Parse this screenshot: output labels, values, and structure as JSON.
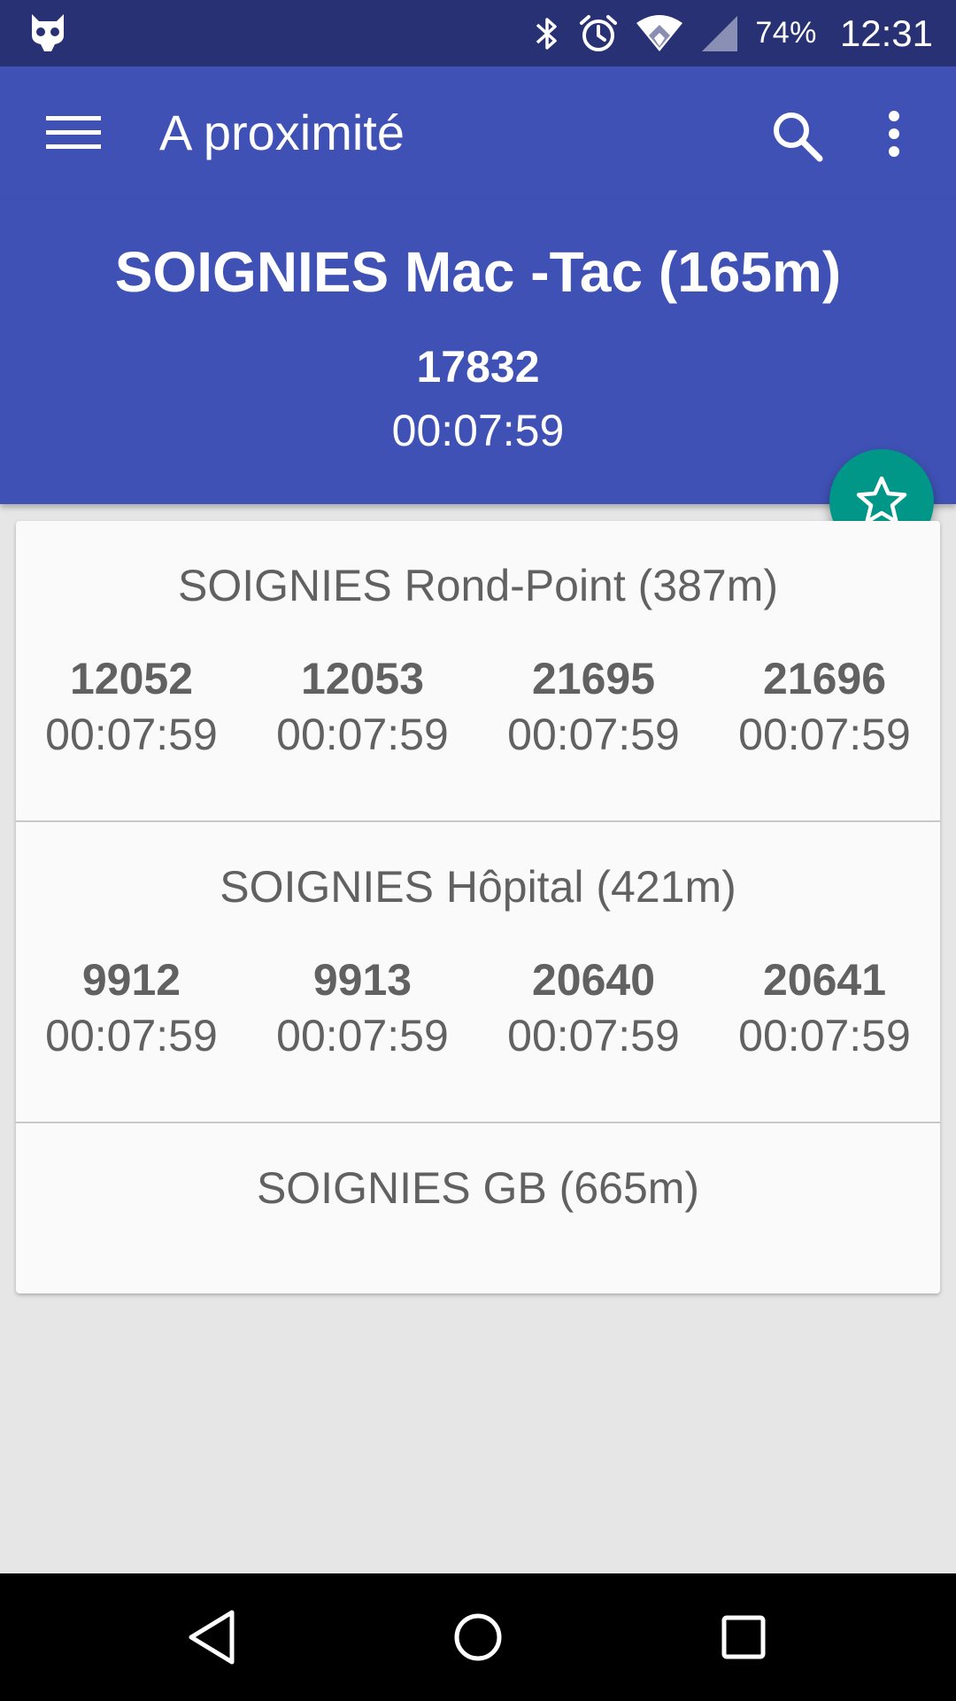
{
  "status_bar": {
    "battery": "74%",
    "time": "12:31",
    "icons": [
      "cyanogen-icon",
      "bluetooth-icon",
      "alarm-icon",
      "wifi-icon",
      "signal-icon"
    ]
  },
  "app_bar": {
    "title": "A proximité",
    "icons": [
      "menu-icon",
      "search-icon",
      "more-vert-icon"
    ]
  },
  "header": {
    "stop": "SOIGNIES Mac -Tac (165m)",
    "line": "17832",
    "time": "00:07:59"
  },
  "fab": {
    "icon": "star-outline-icon",
    "color": "#009688"
  },
  "stops": [
    {
      "name": "SOIGNIES Rond-Point (387m)",
      "departures": [
        {
          "line": "12052",
          "time": "00:07:59"
        },
        {
          "line": "12053",
          "time": "00:07:59"
        },
        {
          "line": "21695",
          "time": "00:07:59"
        },
        {
          "line": "21696",
          "time": "00:07:59"
        }
      ]
    },
    {
      "name": "SOIGNIES Hôpital (421m)",
      "departures": [
        {
          "line": "9912",
          "time": "00:07:59"
        },
        {
          "line": "9913",
          "time": "00:07:59"
        },
        {
          "line": "20640",
          "time": "00:07:59"
        },
        {
          "line": "20641",
          "time": "00:07:59"
        }
      ]
    },
    {
      "name": "SOIGNIES GB (665m)",
      "departures": []
    }
  ],
  "nav_bar": {
    "icons": [
      "back-icon",
      "home-icon",
      "recents-icon"
    ]
  },
  "colors": {
    "primary": "#3f51b5",
    "primary_dark": "#283173",
    "accent": "#009688",
    "text_secondary": "#616161"
  }
}
